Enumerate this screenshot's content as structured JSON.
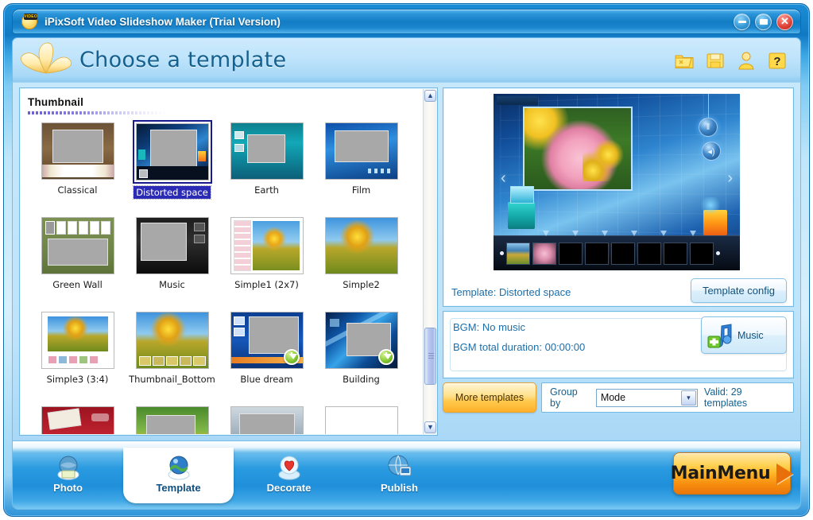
{
  "window": {
    "title": "iPixSoft Video Slideshow Maker (Trial Version)",
    "app_icon": "video-flower-icon",
    "badge_text": "VIDEO",
    "controls": [
      {
        "name": "minimize-button",
        "glyph": "–"
      },
      {
        "name": "restore-button",
        "glyph": "▭"
      },
      {
        "name": "close-button",
        "glyph": "✕"
      }
    ]
  },
  "header": {
    "title": "Choose a template",
    "logo": "flower-logo",
    "icons": [
      {
        "name": "open-project-icon",
        "label": "Open"
      },
      {
        "name": "save-project-icon",
        "label": "Save"
      },
      {
        "name": "user-account-icon",
        "label": "Account"
      },
      {
        "name": "help-icon",
        "label": "Help"
      }
    ]
  },
  "thumbnail_panel": {
    "heading": "Thumbnail",
    "templates": [
      {
        "label": "Classical",
        "selected": false,
        "style": "classical",
        "badge": false
      },
      {
        "label": "Distorted space",
        "selected": true,
        "style": "distorted",
        "badge": false
      },
      {
        "label": "Earth",
        "selected": false,
        "style": "earth",
        "badge": false
      },
      {
        "label": "Film",
        "selected": false,
        "style": "film",
        "badge": false
      },
      {
        "label": "Green Wall",
        "selected": false,
        "style": "greenwall",
        "badge": false
      },
      {
        "label": "Music",
        "selected": false,
        "style": "music",
        "badge": false
      },
      {
        "label": "Simple1 (2x7)",
        "selected": false,
        "style": "simple1",
        "badge": false
      },
      {
        "label": "Simple2",
        "selected": false,
        "style": "simple2",
        "badge": false
      },
      {
        "label": "Simple3 (3:4)",
        "selected": false,
        "style": "simple3",
        "badge": false
      },
      {
        "label": "Thumbnail_Bottom",
        "selected": false,
        "style": "thumbbottom",
        "badge": false
      },
      {
        "label": "Blue dream",
        "selected": false,
        "style": "bluedream",
        "badge": true
      },
      {
        "label": "Building",
        "selected": false,
        "style": "building",
        "badge": true
      },
      {
        "label": "",
        "selected": false,
        "style": "partial-red",
        "badge": false
      },
      {
        "label": "",
        "selected": false,
        "style": "partial-green",
        "badge": false
      },
      {
        "label": "",
        "selected": false,
        "style": "partial-gray",
        "badge": false
      },
      {
        "label": "",
        "selected": false,
        "style": "partial-white",
        "badge": false
      }
    ],
    "scrollbar": {
      "up_glyph": "▲",
      "down_glyph": "▼"
    }
  },
  "preview": {
    "template_line": "Template:  Distorted space",
    "template_config_label": "Template config",
    "stage": {
      "arrow_left": "‹",
      "arrow_right": "›",
      "knob_pause": "‖",
      "knob_volume": "◂)"
    }
  },
  "bgm": {
    "line1": "BGM: No music",
    "line2": "BGM total duration: 00:00:00",
    "music_button_label": "Music"
  },
  "bottom_controls": {
    "more_templates_label": "More templates",
    "group_by_label": "Group by",
    "group_by_value": "Mode",
    "group_by_arrow": "▾",
    "valid_text": "Valid: 29 templates"
  },
  "nav": {
    "items": [
      {
        "label": "Photo",
        "icon": "photo-globe-icon",
        "active": false
      },
      {
        "label": "Template",
        "icon": "template-globe-icon",
        "active": true
      },
      {
        "label": "Decorate",
        "icon": "decorate-heart-icon",
        "active": false
      },
      {
        "label": "Publish",
        "icon": "publish-globe-icon",
        "active": false
      }
    ],
    "main_menu_label": "MainMenu"
  },
  "colors": {
    "accent_blue": "#2a9ae0",
    "frame_blue": "#1179c4",
    "header_title": "#14618f",
    "selection_blue": "#2b2bb5",
    "button_orange": "#ffb224",
    "panel_white": "#ffffff"
  }
}
